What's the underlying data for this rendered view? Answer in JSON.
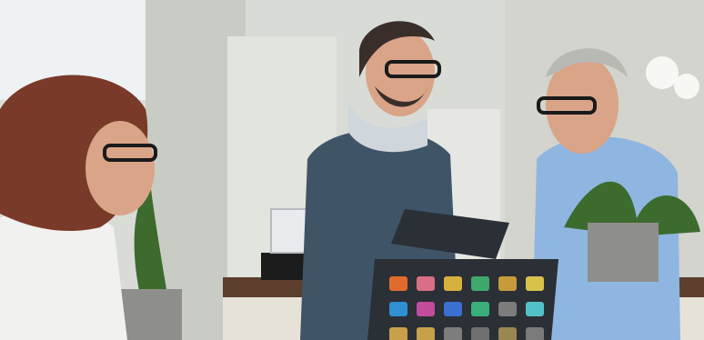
{
  "scene": {
    "alt": "",
    "colors": {
      "wall": "#d9dcd6",
      "wall_shadow": "#b7bbb3",
      "window": "#eef2f4",
      "scrub_blue": "#3f5567",
      "shirt_light_blue": "#8fb6e0",
      "blouse_white": "#f1f1ef",
      "hair_red": "#7a3a2a",
      "hair_dark": "#3a2e2a",
      "hair_gray": "#b8b8b5",
      "skin": "#d9a488",
      "tablet_dark": "#2b2f36",
      "counter_wood": "#5b3e2c",
      "plant_green": "#3d6b2e",
      "pot_gray": "#8e8f8a",
      "orchid_white": "#f7f7f4",
      "device_black": "#1c1c1c"
    },
    "tablet_tiles": [
      "#e06b2c",
      "#d86f86",
      "#d7b13d",
      "#41a86d",
      "#c79b3a",
      "#d8c24b",
      "#2f8fd1",
      "#c24b9b",
      "#3b6fd1",
      "#39b07a",
      "#7c7c7c",
      "#53c2c8",
      "#c7a04a",
      "#c7a04a",
      "#7d7d7d",
      "#6f6f6f",
      "#9a8650",
      "#7a7a7a"
    ]
  }
}
